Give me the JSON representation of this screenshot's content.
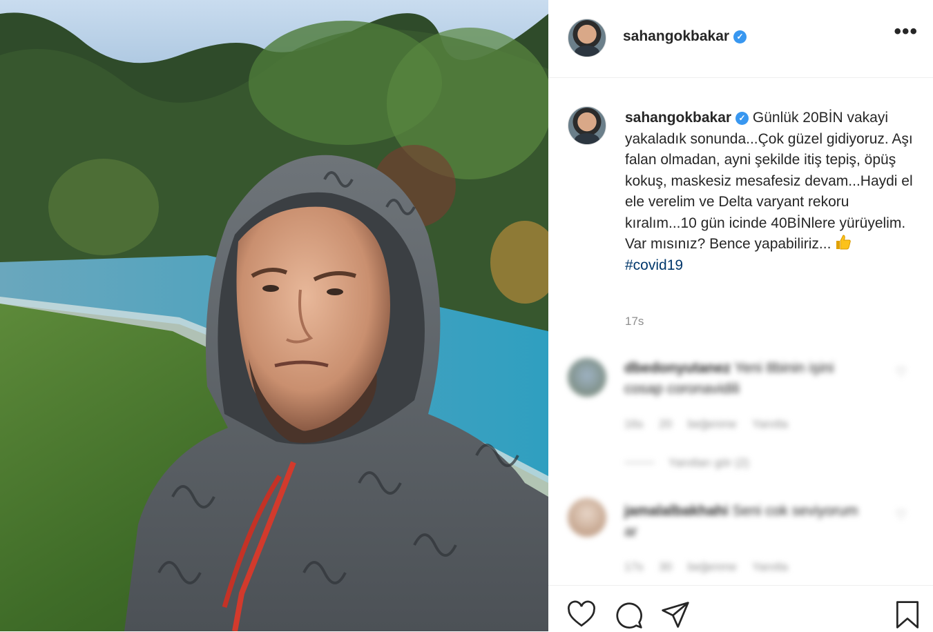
{
  "post": {
    "username": "sahangokbakar",
    "verified_icon": "verified-badge-icon",
    "more_icon": "more-options-icon",
    "more_glyph": "•••",
    "caption": {
      "username": "sahangokbakar",
      "text": "Günlük 20BİN vakayi yakaladık sonunda...Çok güzel gidiyoruz. Aşı falan olmadan, ayni şekilde itiş tepiş, öpüş kokuş, maskesiz mesafesiz devam...Haydi el ele verelim ve Delta varyant rekoru kıralım...10 gün icinde 40BİNlere yürüyelim. Var mısınız? Bence yapabiliriz...",
      "emoji": "thumbs-up-emoji",
      "hashtag": "#covid19"
    },
    "time": "17s"
  },
  "comments": [
    {
      "username": "dbedonyutanez",
      "text": "Yeni 8binin işini cosap coronavidili",
      "time": "16s",
      "likes": "20 beğenme",
      "reply": "Yanıtla",
      "view_replies": "Yanıtları gör (2)"
    },
    {
      "username": "jamalalbakhahi",
      "text": "Seni cok seviyorum ar",
      "time": "17s",
      "likes": "30 beğenme",
      "reply": "Yanıtla"
    }
  ],
  "actions": {
    "like_icon": "heart-icon",
    "comment_icon": "comment-icon",
    "share_icon": "share-icon",
    "save_icon": "bookmark-icon"
  },
  "colors": {
    "link": "#00376b",
    "secondary_text": "#8e8e8e",
    "verified": "#3897f0",
    "divider": "#efefef"
  }
}
